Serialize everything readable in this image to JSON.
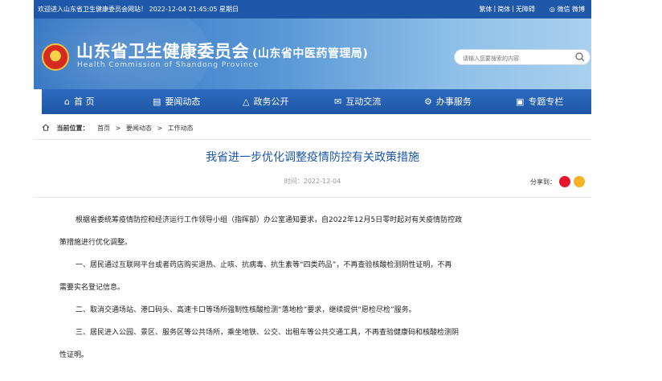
{
  "topbar": {
    "welcome": "欢迎进入山东省卫生健康委员会网站！ 2022-12-04 21:45:05 星期日",
    "links": [
      "繁体",
      "|",
      "简体",
      "|",
      "无障碍"
    ],
    "social": "微信  微博"
  },
  "header": {
    "title": "山东省卫生健康委员会",
    "subtitle": "(山东省中医药管理局)",
    "english": "Health Commission of Shandong Province",
    "search_placeholder": "请输入您要搜索的内容"
  },
  "nav": {
    "items": [
      {
        "label": "首 页",
        "icon": "home-icon"
      },
      {
        "label": "要闻动态",
        "icon": "news-icon"
      },
      {
        "label": "政务公开",
        "icon": "government-icon"
      },
      {
        "label": "互动交流",
        "icon": "interaction-icon"
      },
      {
        "label": "办事服务",
        "icon": "service-icon"
      },
      {
        "label": "专题专栏",
        "icon": "column-icon"
      }
    ]
  },
  "breadcrumb": {
    "label": "当前位置：",
    "items": [
      "首页",
      "要闻动态",
      "工作动态"
    ],
    "sep": ">"
  },
  "article": {
    "title": "我省进一步优化调整疫情防控有关政策措施",
    "time": "时间：2022-12-04",
    "share_label": "分享到：",
    "paragraphs": [
      "根据省委统筹疫情防控和经济运行工作领导小组（指挥部）办公室通知要求，自2022年12月5日零时起对有关疫情防控政",
      "策措施进行优化调整。",
      "一、居民通过互联网平台或者药店购买退热、止咳、抗病毒、抗生素等“四类药品”，不再查验核酸检测阴性证明，不再",
      "需要实名登记信息。",
      "二、取消交通场站、港口码头、高速卡口等场所强制性核酸检测“落地检”要求，继续提供“愿检尽检”服务。",
      "三、居民进入公园、景区、服务区等公共场所，乘坐地铁、公交、出租车等公共交通工具，不再查验健康码和核酸检测阴",
      "性证明。"
    ]
  }
}
